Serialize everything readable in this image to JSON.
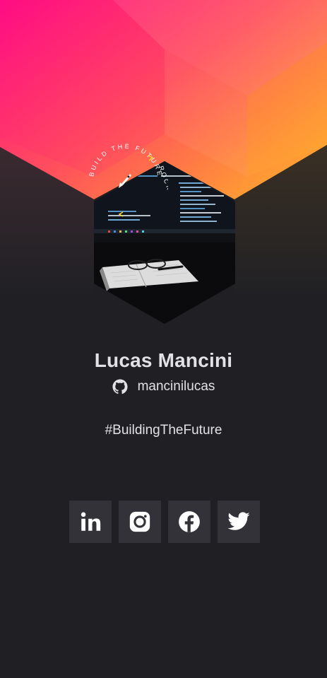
{
  "profile": {
    "name": "Lucas Mancini",
    "github_username": "mancinilucas",
    "hashtag": "#BuildingTheFuture"
  },
  "badge": {
    "ring_text": "BUILD THE FUTURE",
    "side_text": "ROCKETSEAT"
  },
  "social": [
    {
      "name": "linkedin",
      "icon": "linkedin-icon"
    },
    {
      "name": "instagram",
      "icon": "instagram-icon"
    },
    {
      "name": "facebook",
      "icon": "facebook-icon"
    },
    {
      "name": "twitter",
      "icon": "twitter-icon"
    }
  ],
  "colors": {
    "background": "#202024",
    "text": "#E1E1E6",
    "button": "#323238",
    "gradient_start": "#FF008E",
    "gradient_end": "#FFB23C",
    "arrow_accent": "#FFD43B"
  }
}
